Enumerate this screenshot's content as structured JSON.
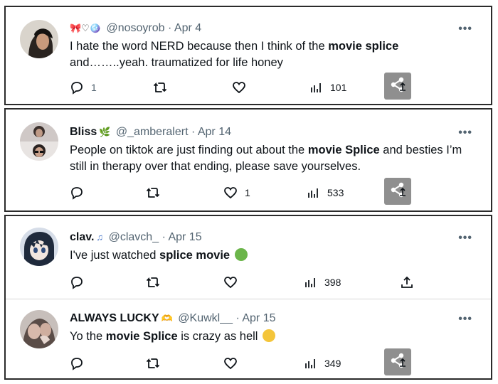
{
  "tweets": [
    {
      "name": "",
      "name_emoji": "🎀♡🪩",
      "handle": "@nosoyrob",
      "date": "Apr 4",
      "text_pre": "I hate the word NERD because then I think of the ",
      "text_bold": "movie splice",
      "text_post": " and……..yeah. traumatized for life honey",
      "replies": "1",
      "retweets": "",
      "likes": "",
      "views": "101",
      "more": "•••"
    },
    {
      "name": "Bliss",
      "name_emoji": "🌿",
      "handle": "@_amberalert",
      "date": "Apr 14",
      "text_pre": "People on tiktok are just finding out about the ",
      "text_bold": "movie Splice",
      "text_post": " and besties I’m still in therapy over that ending, please save yourselves.",
      "replies": "",
      "retweets": "",
      "likes": "1",
      "views": "533",
      "more": "•••"
    },
    {
      "name": "clav.",
      "name_emoji": "♫",
      "handle": "@clavch_",
      "date": "Apr 15",
      "text_pre": "I've just watched ",
      "text_bold": "splice movie",
      "text_post": "",
      "replies": "",
      "retweets": "",
      "likes": "",
      "views": "398",
      "more": "•••"
    },
    {
      "name": "ALWAYS LUCKY",
      "name_emoji": "🫶",
      "handle": "@Kuwkl__",
      "date": "Apr 15",
      "text_pre": "Yo the ",
      "text_bold": "movie Splice",
      "text_post": " is crazy as hell",
      "replies": "",
      "retweets": "",
      "likes": "",
      "views": "349",
      "more": "•••"
    }
  ],
  "separator": "·",
  "colors": {
    "muted": "#536471",
    "text": "#0f1419",
    "share_box": "#8f8f8f",
    "border": "#2b2b2b"
  }
}
